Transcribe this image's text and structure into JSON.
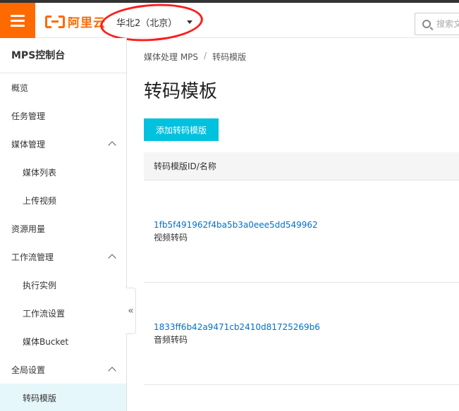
{
  "header": {
    "logo_text": "阿里云",
    "region": "华北2（北京）",
    "search_placeholder": "搜索文"
  },
  "sidebar": {
    "title": "MPS控制台",
    "items": [
      {
        "label": "概览"
      },
      {
        "label": "任务管理"
      },
      {
        "label": "媒体管理"
      },
      {
        "label": "媒体列表"
      },
      {
        "label": "上传视频"
      },
      {
        "label": "资源用量"
      },
      {
        "label": "工作流管理"
      },
      {
        "label": "执行实例"
      },
      {
        "label": "工作流设置"
      },
      {
        "label": "媒体Bucket"
      },
      {
        "label": "全局设置"
      },
      {
        "label": "转码模版"
      }
    ],
    "collapse_glyph": "«"
  },
  "main": {
    "breadcrumb": [
      "媒体处理 MPS",
      "/",
      "转码模版"
    ],
    "title": "转码模板",
    "add_button": "添加转码模版",
    "table": {
      "header": "转码模版ID/名称",
      "rows": [
        {
          "id": "1fb5f491962f4ba5b3a0eee5dd549962",
          "name": "视频转码"
        },
        {
          "id": "1833ff6b42a9471cb2410d81725269b6",
          "name": "音频转码"
        }
      ]
    }
  },
  "colors": {
    "brand": "#ff6a00",
    "primary_button": "#00c1de",
    "link": "#0070cc",
    "active_nav_bg": "#e6f7fc",
    "annotation": "#ff1a1a"
  }
}
